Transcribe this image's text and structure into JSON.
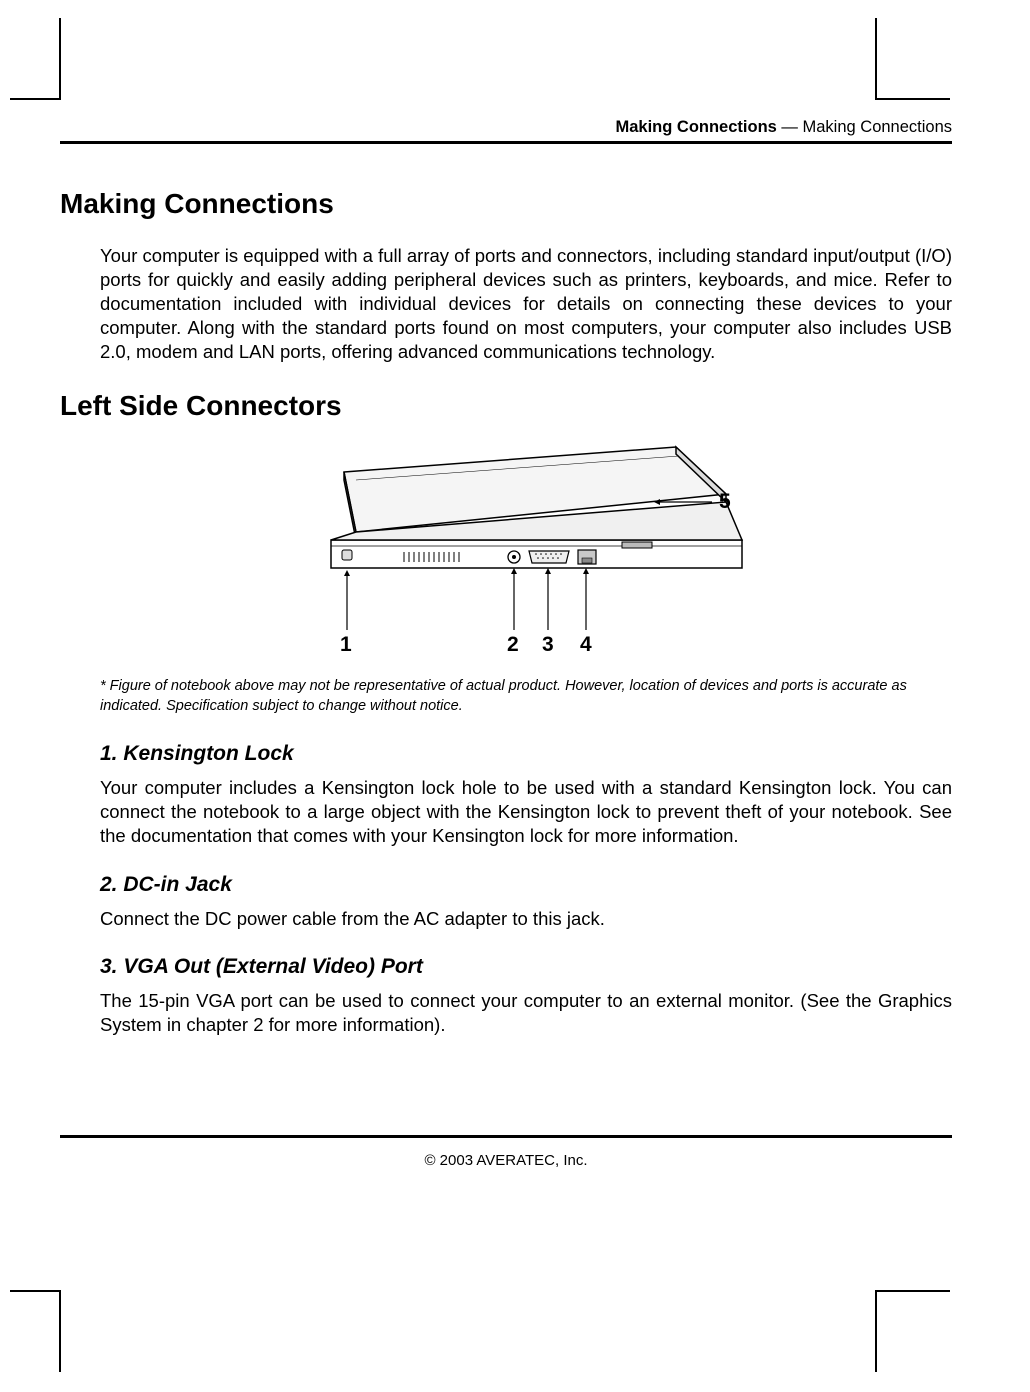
{
  "header": {
    "bold_part": "Making Connections",
    "separator": " — ",
    "normal_part": "Making Connections"
  },
  "heading_main": "Making Connections",
  "intro_paragraph": "Your computer is equipped with a full array of ports and connectors, including standard input/output (I/O) ports for quickly and easily adding peripheral devices such as printers, keyboards, and mice. Refer to documentation included with individual devices for details on connecting these devices to your computer. Along with the standard ports found on most computers, your computer also includes USB 2.0, modem and LAN ports, offering advanced communications technology.",
  "heading_left_side": "Left Side Connectors",
  "figure_callouts": {
    "c1": "1",
    "c2": "2",
    "c3": "3",
    "c4": "4",
    "c5": "5"
  },
  "figure_caption": "* Figure of notebook above may not be representative of actual product.  However, location of devices and ports is accurate as indicated. Specification subject to change without notice.",
  "section_1": {
    "title": "1. Kensington Lock",
    "body": "Your computer includes a Kensington lock hole to be used with a standard Kensington lock. You can connect the notebook to a large object with the Kensington lock to prevent theft of your notebook. See the documentation that comes with your Kensington lock for more information."
  },
  "section_2": {
    "title": "2. DC-in Jack",
    "body": "Connect the DC power cable from the AC adapter to this jack."
  },
  "section_3": {
    "title": "3. VGA Out (External Video) Port",
    "body": "The 15-pin VGA port can be used to connect your computer to an external monitor. (See the Graphics System in chapter 2 for more information)."
  },
  "footer": "© 2003 AVERATEC, Inc."
}
